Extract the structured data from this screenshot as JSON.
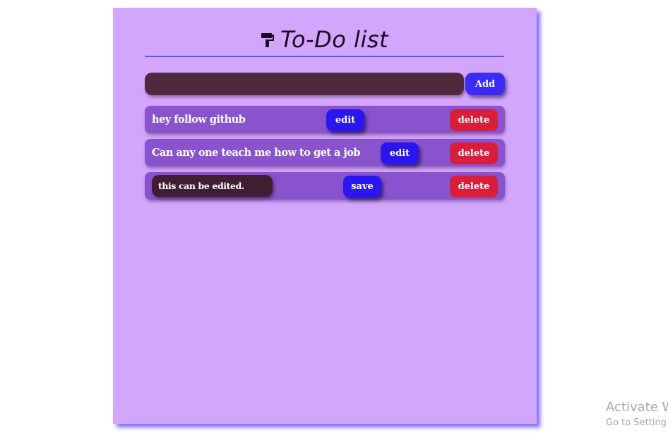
{
  "app": {
    "title": "To-Do list",
    "title_icon": "paint-roller-icon"
  },
  "entry": {
    "value": "",
    "add_label": "Add"
  },
  "todos": [
    {
      "text": "hey follow github",
      "action_label": "edit",
      "delete_label": "delete",
      "editing": false
    },
    {
      "text": "Can any one teach me how to get a job",
      "action_label": "edit",
      "delete_label": "delete",
      "editing": false
    },
    {
      "text": "this can be edited.",
      "action_label": "save",
      "delete_label": "delete",
      "editing": true
    }
  ],
  "colors": {
    "card_bg": "#d3a6fd",
    "item_bg": "#8853cc",
    "input_bg": "#4f2a3f",
    "edit_input_bg": "#3f1e33",
    "primary_button": "#2a16ee",
    "delete_button": "#d81e3a",
    "divider": "#5a5ae6"
  },
  "watermark": {
    "title": "Activate W",
    "subtitle": "Go to Setting"
  }
}
